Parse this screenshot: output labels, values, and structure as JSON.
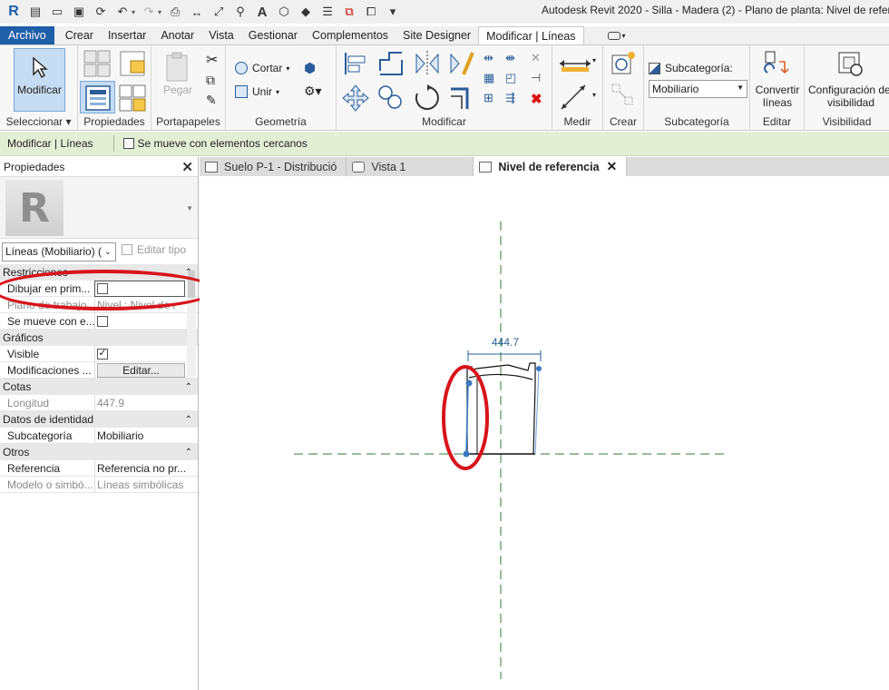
{
  "window": {
    "title": "Autodesk Revit 2020 - Silla - Madera (2) - Plano de planta: Nivel de refer"
  },
  "ribbon_tabs": [
    "Archivo",
    "Crear",
    "Insertar",
    "Anotar",
    "Vista",
    "Gestionar",
    "Complementos",
    "Site Designer",
    "Modificar | Líneas"
  ],
  "ribbon": {
    "modificar_label": "Modificar",
    "pegar_label": "Pegar",
    "cortar_label": "Cortar",
    "unir_label": "Unir",
    "subcategoria_label": "Subcategoría:",
    "subcategoria_value": "Mobiliario",
    "convertir_label": "Convertir",
    "convertir_label2": "líneas",
    "config_label": "Configuración de",
    "config_label2": "visibilidad",
    "panels": {
      "seleccionar": "Seleccionar",
      "propiedades": "Propiedades",
      "portapapeles": "Portapapeles",
      "geometria": "Geometría",
      "modificar": "Modificar",
      "medir": "Medir",
      "crear": "Crear",
      "subcategoria": "Subcategoría",
      "editar": "Editar",
      "visibilidad": "Visibilidad"
    }
  },
  "options_bar": {
    "context": "Modificar | Líneas",
    "checkbox_label": "Se mueve con elementos cercanos"
  },
  "properties": {
    "title": "Propiedades",
    "type_selector": "Líneas (Mobiliario) (",
    "edit_type": "Editar tipo",
    "sections": [
      {
        "name": "Restricciones",
        "rows": [
          {
            "name": "Dibujar en prim...",
            "value": "",
            "kind": "checkbox",
            "checked": false
          },
          {
            "name": "Plano de trabajo",
            "value": "Nivel : Nivel de r",
            "kind": "grey"
          },
          {
            "name": "Se mueve con e...",
            "value": "",
            "kind": "checkbox",
            "checked": false
          }
        ]
      },
      {
        "name": "Gráficos",
        "rows": [
          {
            "name": "Visible",
            "value": "",
            "kind": "checkbox",
            "checked": true
          },
          {
            "name": "Modificaciones ...",
            "value": "Editar...",
            "kind": "button"
          }
        ]
      },
      {
        "name": "Cotas",
        "rows": [
          {
            "name": "Longitud",
            "value": "447.9",
            "kind": "grey"
          }
        ]
      },
      {
        "name": "Datos de identidad",
        "rows": [
          {
            "name": "Subcategoría",
            "value": "Mobiliario",
            "kind": "text"
          }
        ]
      },
      {
        "name": "Otros",
        "rows": [
          {
            "name": "Referencia",
            "value": "Referencia no pr...",
            "kind": "text"
          },
          {
            "name": "Modelo o simbó...",
            "value": "Líneas simbólicas",
            "kind": "grey"
          }
        ]
      }
    ]
  },
  "view_tabs": [
    "Suelo P-1 - Distribució",
    "Vista 1",
    "Nivel de referencia"
  ],
  "canvas": {
    "dimension": "444.7"
  },
  "colors": {
    "archivo": "#1f5ea8",
    "options_bar": "#e3efd5",
    "annotation": "#d8141b",
    "guide": "#2e7d32",
    "selection": "#3a78c2"
  }
}
